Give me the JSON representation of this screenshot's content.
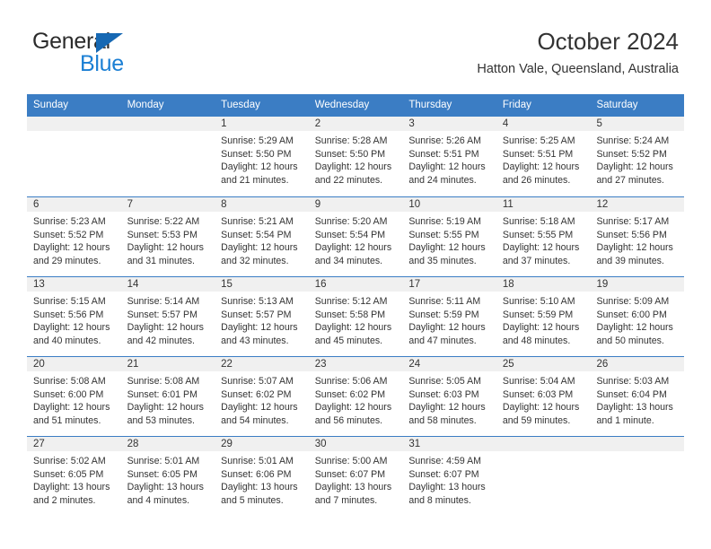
{
  "brand": {
    "name_top": "General",
    "name_bottom": "Blue",
    "accent_color": "#1b7fd4",
    "triangle_color": "#1668b3"
  },
  "header": {
    "title": "October 2024",
    "subtitle": "Hatton Vale, Queensland, Australia"
  },
  "calendar": {
    "header_bg": "#3b7dc4",
    "daynum_bg": "#f0f0f0",
    "weekdays": [
      "Sunday",
      "Monday",
      "Tuesday",
      "Wednesday",
      "Thursday",
      "Friday",
      "Saturday"
    ],
    "labels": {
      "sunrise": "Sunrise:",
      "sunset": "Sunset:",
      "daylight": "Daylight:"
    },
    "weeks": [
      [
        {
          "day": "",
          "lines": []
        },
        {
          "day": "",
          "lines": []
        },
        {
          "day": "1",
          "lines": [
            "Sunrise: 5:29 AM",
            "Sunset: 5:50 PM",
            "Daylight: 12 hours",
            "and 21 minutes."
          ]
        },
        {
          "day": "2",
          "lines": [
            "Sunrise: 5:28 AM",
            "Sunset: 5:50 PM",
            "Daylight: 12 hours",
            "and 22 minutes."
          ]
        },
        {
          "day": "3",
          "lines": [
            "Sunrise: 5:26 AM",
            "Sunset: 5:51 PM",
            "Daylight: 12 hours",
            "and 24 minutes."
          ]
        },
        {
          "day": "4",
          "lines": [
            "Sunrise: 5:25 AM",
            "Sunset: 5:51 PM",
            "Daylight: 12 hours",
            "and 26 minutes."
          ]
        },
        {
          "day": "5",
          "lines": [
            "Sunrise: 5:24 AM",
            "Sunset: 5:52 PM",
            "Daylight: 12 hours",
            "and 27 minutes."
          ]
        }
      ],
      [
        {
          "day": "6",
          "lines": [
            "Sunrise: 5:23 AM",
            "Sunset: 5:52 PM",
            "Daylight: 12 hours",
            "and 29 minutes."
          ]
        },
        {
          "day": "7",
          "lines": [
            "Sunrise: 5:22 AM",
            "Sunset: 5:53 PM",
            "Daylight: 12 hours",
            "and 31 minutes."
          ]
        },
        {
          "day": "8",
          "lines": [
            "Sunrise: 5:21 AM",
            "Sunset: 5:54 PM",
            "Daylight: 12 hours",
            "and 32 minutes."
          ]
        },
        {
          "day": "9",
          "lines": [
            "Sunrise: 5:20 AM",
            "Sunset: 5:54 PM",
            "Daylight: 12 hours",
            "and 34 minutes."
          ]
        },
        {
          "day": "10",
          "lines": [
            "Sunrise: 5:19 AM",
            "Sunset: 5:55 PM",
            "Daylight: 12 hours",
            "and 35 minutes."
          ]
        },
        {
          "day": "11",
          "lines": [
            "Sunrise: 5:18 AM",
            "Sunset: 5:55 PM",
            "Daylight: 12 hours",
            "and 37 minutes."
          ]
        },
        {
          "day": "12",
          "lines": [
            "Sunrise: 5:17 AM",
            "Sunset: 5:56 PM",
            "Daylight: 12 hours",
            "and 39 minutes."
          ]
        }
      ],
      [
        {
          "day": "13",
          "lines": [
            "Sunrise: 5:15 AM",
            "Sunset: 5:56 PM",
            "Daylight: 12 hours",
            "and 40 minutes."
          ]
        },
        {
          "day": "14",
          "lines": [
            "Sunrise: 5:14 AM",
            "Sunset: 5:57 PM",
            "Daylight: 12 hours",
            "and 42 minutes."
          ]
        },
        {
          "day": "15",
          "lines": [
            "Sunrise: 5:13 AM",
            "Sunset: 5:57 PM",
            "Daylight: 12 hours",
            "and 43 minutes."
          ]
        },
        {
          "day": "16",
          "lines": [
            "Sunrise: 5:12 AM",
            "Sunset: 5:58 PM",
            "Daylight: 12 hours",
            "and 45 minutes."
          ]
        },
        {
          "day": "17",
          "lines": [
            "Sunrise: 5:11 AM",
            "Sunset: 5:59 PM",
            "Daylight: 12 hours",
            "and 47 minutes."
          ]
        },
        {
          "day": "18",
          "lines": [
            "Sunrise: 5:10 AM",
            "Sunset: 5:59 PM",
            "Daylight: 12 hours",
            "and 48 minutes."
          ]
        },
        {
          "day": "19",
          "lines": [
            "Sunrise: 5:09 AM",
            "Sunset: 6:00 PM",
            "Daylight: 12 hours",
            "and 50 minutes."
          ]
        }
      ],
      [
        {
          "day": "20",
          "lines": [
            "Sunrise: 5:08 AM",
            "Sunset: 6:00 PM",
            "Daylight: 12 hours",
            "and 51 minutes."
          ]
        },
        {
          "day": "21",
          "lines": [
            "Sunrise: 5:08 AM",
            "Sunset: 6:01 PM",
            "Daylight: 12 hours",
            "and 53 minutes."
          ]
        },
        {
          "day": "22",
          "lines": [
            "Sunrise: 5:07 AM",
            "Sunset: 6:02 PM",
            "Daylight: 12 hours",
            "and 54 minutes."
          ]
        },
        {
          "day": "23",
          "lines": [
            "Sunrise: 5:06 AM",
            "Sunset: 6:02 PM",
            "Daylight: 12 hours",
            "and 56 minutes."
          ]
        },
        {
          "day": "24",
          "lines": [
            "Sunrise: 5:05 AM",
            "Sunset: 6:03 PM",
            "Daylight: 12 hours",
            "and 58 minutes."
          ]
        },
        {
          "day": "25",
          "lines": [
            "Sunrise: 5:04 AM",
            "Sunset: 6:03 PM",
            "Daylight: 12 hours",
            "and 59 minutes."
          ]
        },
        {
          "day": "26",
          "lines": [
            "Sunrise: 5:03 AM",
            "Sunset: 6:04 PM",
            "Daylight: 13 hours",
            "and 1 minute."
          ]
        }
      ],
      [
        {
          "day": "27",
          "lines": [
            "Sunrise: 5:02 AM",
            "Sunset: 6:05 PM",
            "Daylight: 13 hours",
            "and 2 minutes."
          ]
        },
        {
          "day": "28",
          "lines": [
            "Sunrise: 5:01 AM",
            "Sunset: 6:05 PM",
            "Daylight: 13 hours",
            "and 4 minutes."
          ]
        },
        {
          "day": "29",
          "lines": [
            "Sunrise: 5:01 AM",
            "Sunset: 6:06 PM",
            "Daylight: 13 hours",
            "and 5 minutes."
          ]
        },
        {
          "day": "30",
          "lines": [
            "Sunrise: 5:00 AM",
            "Sunset: 6:07 PM",
            "Daylight: 13 hours",
            "and 7 minutes."
          ]
        },
        {
          "day": "31",
          "lines": [
            "Sunrise: 4:59 AM",
            "Sunset: 6:07 PM",
            "Daylight: 13 hours",
            "and 8 minutes."
          ]
        },
        {
          "day": "",
          "lines": []
        },
        {
          "day": "",
          "lines": []
        }
      ]
    ]
  }
}
